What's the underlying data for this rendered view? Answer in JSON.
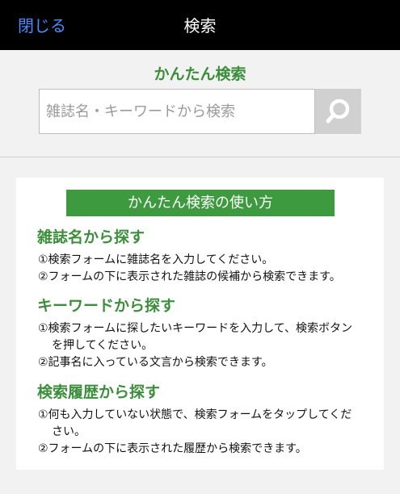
{
  "header": {
    "close_label": "閉じる",
    "title": "検索"
  },
  "search": {
    "heading": "かんたん検索",
    "placeholder": "雑誌名・キーワードから検索",
    "button_icon": "search-icon"
  },
  "help": {
    "banner": "かんたん検索の使い方",
    "sections": [
      {
        "title": "雑誌名から探す",
        "lines": [
          "①検索フォームに雑誌名を入力してください。",
          "②フォームの下に表示された雑誌の候補から検索できます。"
        ]
      },
      {
        "title": "キーワードから探す",
        "lines": [
          "①検索フォームに探したいキーワードを入力して、検索ボタン",
          "を押してください。",
          "②記事名に入っている文言から検索できます。"
        ]
      },
      {
        "title": "検索履歴から探す",
        "lines": [
          "①何も入力していない状態で、検索フォームをタップしてくだ",
          "さい。",
          "②フォームの下に表示された履歴から検索できます。"
        ]
      }
    ]
  },
  "colors": {
    "header_bg": "#000000",
    "accent_green": "#3d9a3e",
    "link_blue": "#4a8cff"
  }
}
